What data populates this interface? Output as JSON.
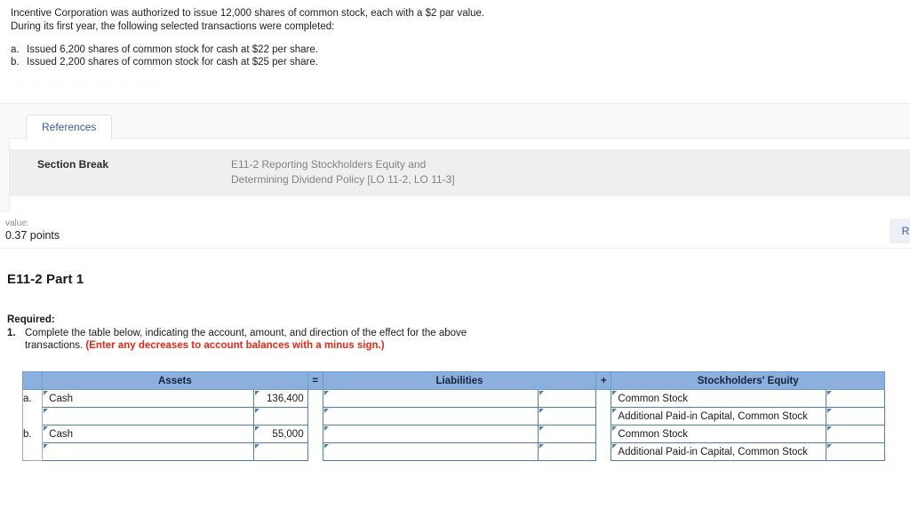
{
  "problem": {
    "lines": [
      "Incentive Corporation was authorized to issue 12,000 shares of common stock, each with a $2 par value.",
      "During its first year, the following selected transactions were completed:"
    ],
    "transactions": [
      {
        "marker": "a.",
        "text": "Issued 6,200 shares of common stock for cash at $22 per share."
      },
      {
        "marker": "b.",
        "text": "Issued 2,200 shares of common stock for cash at $25 per share."
      }
    ],
    "revision_note": "rev: 10_28_2015_QC_CS-29788"
  },
  "references": {
    "tab_label": "References",
    "row_label": "Section Break",
    "row_desc_line1": "E11-2 Reporting Stockholders Equity and",
    "row_desc_line2": "Determining Dividend Policy [LO 11-2, LO 11-3]"
  },
  "value_bar": {
    "caption": "value:",
    "amount": "0.37 points",
    "button_label": "Rec"
  },
  "question": {
    "heading": "E11-2 Part 1",
    "required_label": "Required:",
    "item_number": "1.",
    "item_line1": "Complete the table below, indicating the account, amount, and direction of the effect for the above",
    "item_line2_plain": "transactions. ",
    "item_line2_warn": "(Enter any decreases to account balances with a minus sign.)"
  },
  "table": {
    "headers": {
      "corner": "",
      "assets": "Assets",
      "equals": "=",
      "liabilities": "Liabilities",
      "plus": "+",
      "equity": "Stockholders' Equity"
    },
    "rows": [
      {
        "label": "a.",
        "asset_account": "Cash",
        "asset_amount": "136,400",
        "liability_account": "",
        "liability_amount": "",
        "equity_account": "Common Stock",
        "equity_amount": ""
      },
      {
        "label": "",
        "asset_account": "",
        "asset_amount": "",
        "liability_account": "",
        "liability_amount": "",
        "equity_account": "Additional Paid-in Capital, Common Stock",
        "equity_amount": ""
      },
      {
        "label": "b.",
        "asset_account": "Cash",
        "asset_amount": "55,000",
        "liability_account": "",
        "liability_amount": "",
        "equity_account": "Common Stock",
        "equity_amount": ""
      },
      {
        "label": "",
        "asset_account": "",
        "asset_amount": "",
        "liability_account": "",
        "liability_amount": "",
        "equity_account": "Additional Paid-in Capital, Common Stock",
        "equity_amount": ""
      }
    ]
  },
  "colors": {
    "header_blue": "#8bb0dd",
    "cell_border_blue": "#4f7cb3",
    "link_blue": "#3b5b9a",
    "warning_red": "#e02b19"
  }
}
